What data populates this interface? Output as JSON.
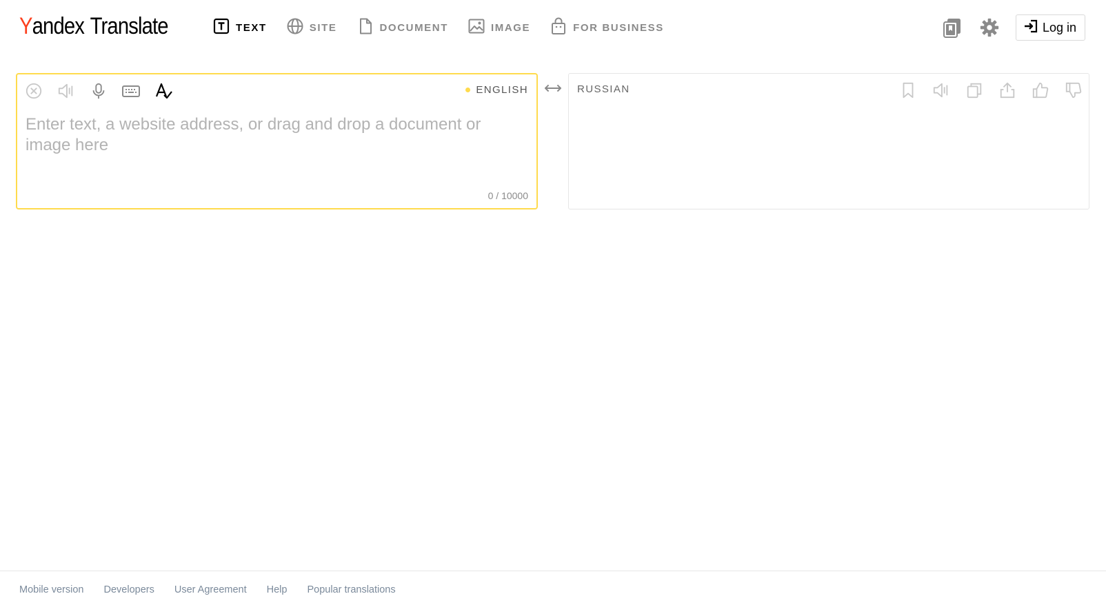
{
  "logo": {
    "brand_first": "Y",
    "brand_rest": "andex",
    "product": "Translate",
    "brand_color": "#fc3f1d"
  },
  "nav": {
    "items": [
      {
        "label": "TEXT",
        "icon": "text-icon",
        "active": true
      },
      {
        "label": "SITE",
        "icon": "globe-icon",
        "active": false
      },
      {
        "label": "DOCUMENT",
        "icon": "document-icon",
        "active": false
      },
      {
        "label": "IMAGE",
        "icon": "image-icon",
        "active": false
      },
      {
        "label": "FOR BUSINESS",
        "icon": "briefcase-icon",
        "active": false
      }
    ]
  },
  "header_right": {
    "collections_icon": "collections-icon",
    "settings_icon": "gear-icon",
    "login_label": "Log in",
    "login_icon": "login-icon"
  },
  "source": {
    "language": "ENGLISH",
    "placeholder": "Enter text, a website address, or drag and drop a document or image here",
    "value": "",
    "counter": "0 / 10000",
    "tools": [
      "clear-icon",
      "speaker-icon",
      "microphone-icon",
      "keyboard-icon",
      "spellcheck-icon"
    ],
    "accent": "#ffdb4d"
  },
  "target": {
    "language": "RUSSIAN",
    "tools": [
      "bookmark-icon",
      "speaker-icon",
      "copy-icon",
      "share-icon",
      "thumbs-up-icon",
      "thumbs-down-icon"
    ]
  },
  "swap_icon": "swap-arrows-icon",
  "footer": {
    "links": [
      "Mobile version",
      "Developers",
      "User Agreement",
      "Help",
      "Popular translations"
    ]
  }
}
